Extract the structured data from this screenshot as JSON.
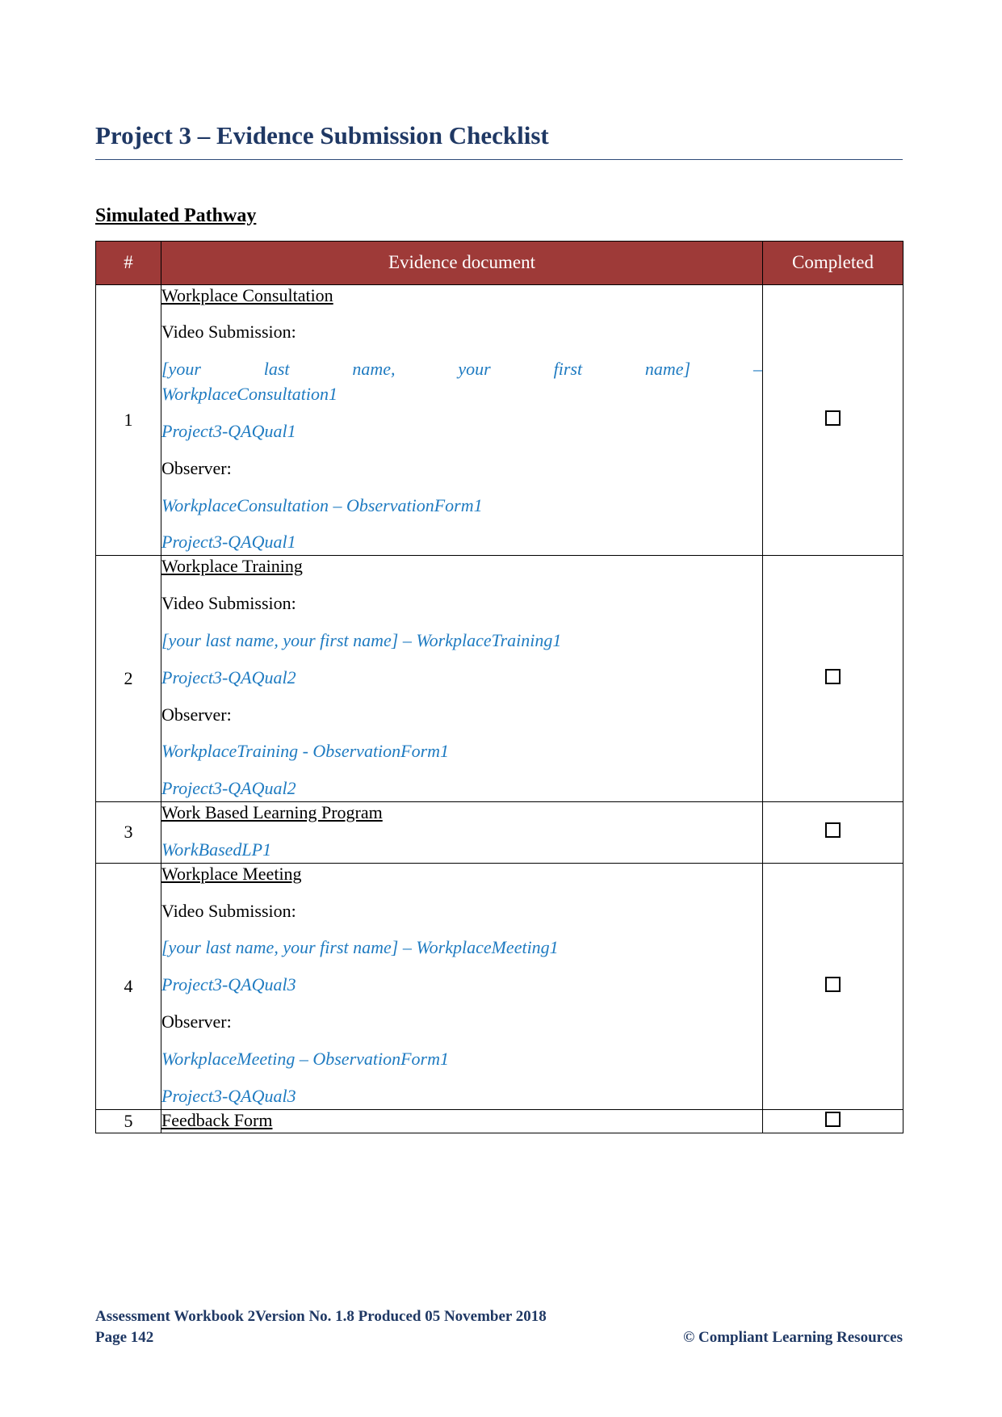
{
  "document": {
    "title": "Project 3 – Evidence Submission Checklist",
    "section_heading": "Simulated Pathway"
  },
  "table": {
    "headers": {
      "number": "#",
      "evidence": "Evidence document",
      "completed": "Completed"
    },
    "header_bg": "#9E3A38",
    "header_text_color": "#FFFFFF",
    "link_color": "#1F7BC1",
    "rows": [
      {
        "number": "1",
        "title": "Workplace Consultation",
        "video_label": "Video Submission:",
        "video_file_line1": "[your last name, your first name]",
        "video_file_dash": "–",
        "video_file_line2": "WorkplaceConsultation1",
        "video_code": "Project3-QAQual1",
        "observer_label": "Observer:",
        "observer_file": "WorkplaceConsultation – ObservationForm1",
        "observer_code": "Project3-QAQual1",
        "completed_checkbox": "unchecked"
      },
      {
        "number": "2",
        "title": "Workplace Training",
        "video_label": "Video Submission:",
        "video_file": "[your last name, your first name] – WorkplaceTraining1",
        "video_code": "Project3-QAQual2",
        "observer_label": "Observer:",
        "observer_file": "WorkplaceTraining - ObservationForm1",
        "observer_code": "Project3-QAQual2",
        "completed_checkbox": "unchecked"
      },
      {
        "number": "3",
        "title": "Work Based Learning Program",
        "video_code": "WorkBasedLP1",
        "completed_checkbox": "unchecked"
      },
      {
        "number": "4",
        "title": "Workplace Meeting",
        "video_label": "Video Submission:",
        "video_file": "[your last name, your first name] – WorkplaceMeeting1",
        "video_code": "Project3-QAQual3",
        "observer_label": "Observer:",
        "observer_file": "WorkplaceMeeting – ObservationForm1",
        "observer_code": "Project3-QAQual3",
        "completed_checkbox": "unchecked"
      },
      {
        "number": "5",
        "title": "Feedback Form",
        "completed_checkbox": "unchecked"
      }
    ]
  },
  "footer": {
    "left_line1": "Assessment Workbook 2Version No. 1.8 Produced 05 November 2018",
    "left_line2": "Page 142",
    "right_line2": "© Compliant Learning Resources"
  }
}
